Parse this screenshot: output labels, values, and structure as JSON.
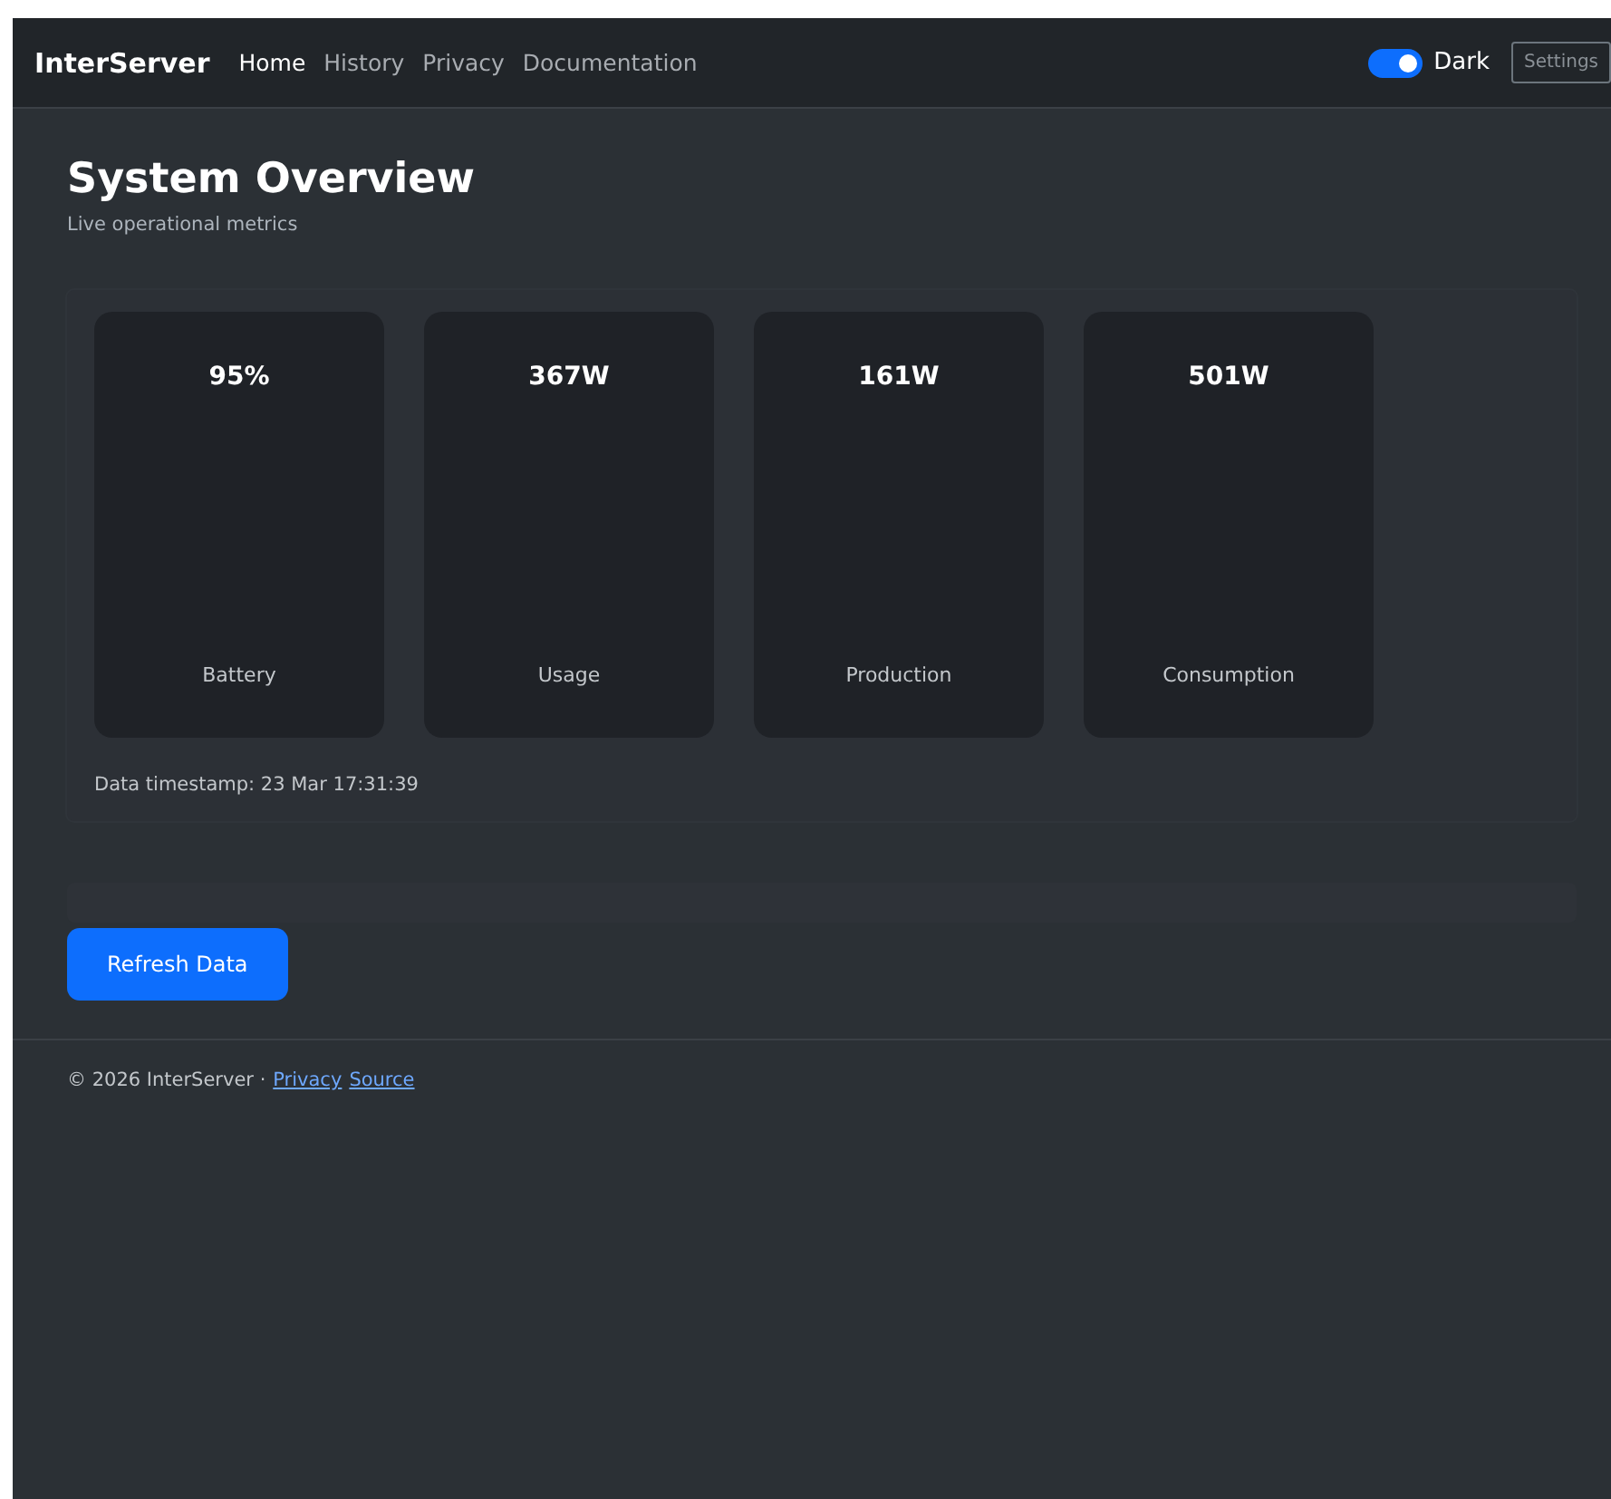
{
  "navbar": {
    "brand": "InterServer",
    "links": [
      {
        "label": "Home",
        "selected": true
      },
      {
        "label": "History",
        "selected": false
      },
      {
        "label": "Privacy",
        "selected": false
      },
      {
        "label": "Documentation",
        "selected": false
      }
    ],
    "theme_toggle": {
      "label": "Dark",
      "on": true
    },
    "settings_button": "Settings"
  },
  "header": {
    "title": "System Overview",
    "subtitle": "Live operational metrics"
  },
  "metrics": [
    {
      "value": "95%",
      "label": "Battery"
    },
    {
      "value": "367W",
      "label": "Usage"
    },
    {
      "value": "161W",
      "label": "Production"
    },
    {
      "value": "501W",
      "label": "Consumption"
    }
  ],
  "timestamp": "Data timestamp: 23 Mar 17:31:39",
  "refresh_button": "Refresh Data",
  "footer": {
    "text": "© 2026 InterServer ·",
    "links": [
      "Privacy",
      "Source"
    ]
  }
}
